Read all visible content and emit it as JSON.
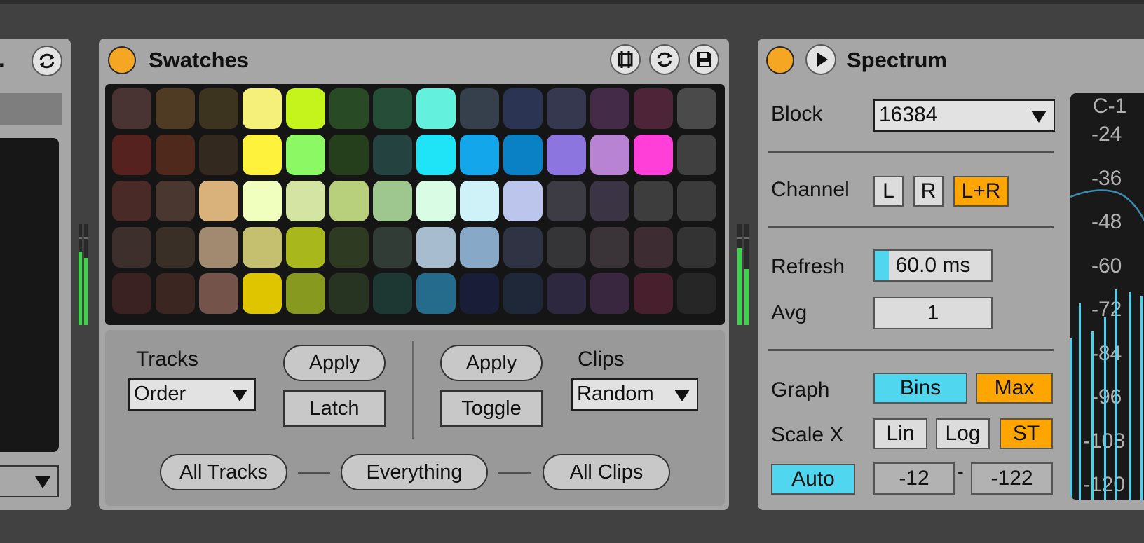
{
  "colors": {
    "background": "#414141",
    "device_bg": "#a6a6a6",
    "accent_orange": "#ffa500",
    "accent_cyan": "#50d6ee",
    "meter_green": "#3ad44a"
  },
  "left_device": {
    "title_fragment": ".",
    "refresh_icon": "refresh-icon"
  },
  "swatches": {
    "title": "Swatches",
    "icons": [
      "stamp-icon",
      "refresh-icon",
      "save-icon"
    ],
    "grid_colors": [
      [
        "#4a3333",
        "#4f3a24",
        "#3d3420",
        "#f5f07a",
        "#c5f41d",
        "#284a25",
        "#254d38",
        "#63f0dd",
        "#35404c",
        "#2b3452",
        "#35384f",
        "#442c48",
        "#4d2438",
        "#4a4a4a"
      ],
      [
        "#552220",
        "#4f2a1c",
        "#33291f",
        "#fff23d",
        "#8cf964",
        "#253e1c",
        "#244240",
        "#1fe4f8",
        "#14a6ea",
        "#0a80c5",
        "#8d75e0",
        "#b883d3",
        "#ff3fd8",
        "#404040"
      ],
      [
        "#4a2a26",
        "#4a3830",
        "#d8b27a",
        "#f1ffbe",
        "#d4e5a3",
        "#b8d07c",
        "#9dc78e",
        "#d8fde4",
        "#cef2f8",
        "#bcc6ec",
        "#3d3b44",
        "#3b3445",
        "#3d3d3d",
        "#3b3b3b"
      ],
      [
        "#3d2f2b",
        "#3a2f27",
        "#a28a70",
        "#c5bf70",
        "#a8b71b",
        "#2f3a23",
        "#313c36",
        "#a7bccf",
        "#88a8c8",
        "#2f3344",
        "#353538",
        "#3a3338",
        "#3d2d33",
        "#333333"
      ],
      [
        "#3a2223",
        "#3b2622",
        "#74534a",
        "#dfc400",
        "#87991e",
        "#263421",
        "#1d3832",
        "#256c8c",
        "#1a1d38",
        "#1f2838",
        "#2d2740",
        "#39263f",
        "#48202d",
        "#262626"
      ]
    ],
    "tracks_label": "Tracks",
    "tracks_select": "Order",
    "apply_label": "Apply",
    "latch_label": "Latch",
    "clips_label": "Clips",
    "clips_select": "Random",
    "toggle_label": "Toggle",
    "all_tracks_label": "All Tracks",
    "everything_label": "Everything",
    "all_clips_label": "All Clips"
  },
  "spectrum": {
    "title": "Spectrum",
    "block_label": "Block",
    "block_value": "16384",
    "channel_label": "Channel",
    "channel_options": [
      "L",
      "R",
      "L+R"
    ],
    "channel_selected": "L+R",
    "refresh_label": "Refresh",
    "refresh_value": "60.0 ms",
    "refresh_fill": 0.12,
    "avg_label": "Avg",
    "avg_value": "1",
    "graph_label": "Graph",
    "graph_bins": "Bins",
    "graph_max": "Max",
    "scale_x_label": "Scale X",
    "scale_lin": "Lin",
    "scale_log": "Log",
    "scale_st": "ST",
    "auto_label": "Auto",
    "range_low": "-12",
    "range_sep": "-",
    "range_high": "-122",
    "note_label": "C-1",
    "db_labels": [
      "-24",
      "-36",
      "-48",
      "-60",
      "-72",
      "-84",
      "-96",
      "-108",
      "-120"
    ]
  }
}
